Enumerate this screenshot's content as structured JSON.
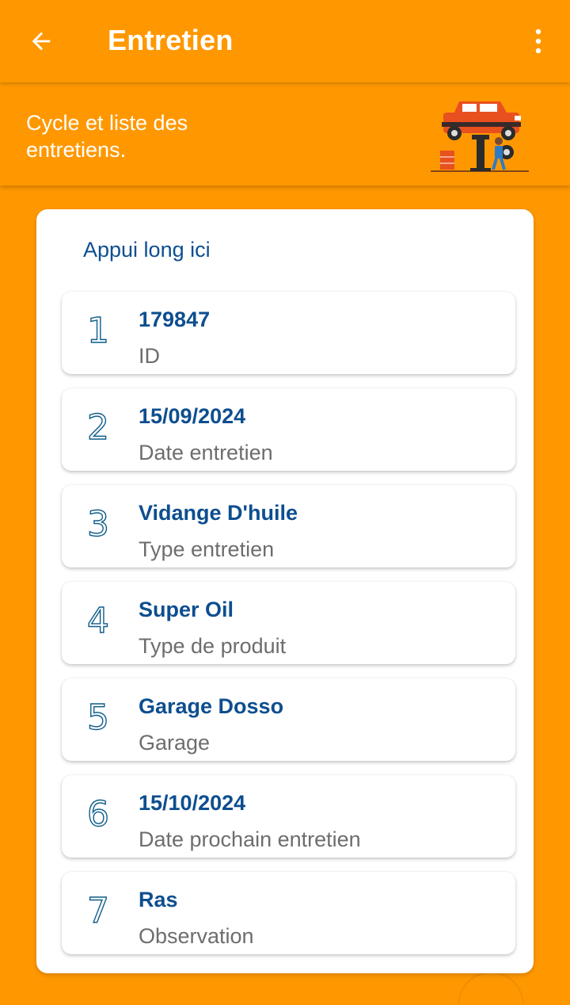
{
  "appbar": {
    "title": "Entretien"
  },
  "header": {
    "description": "Cycle et liste des entretiens."
  },
  "card": {
    "hint": "Appui long ici",
    "items": [
      {
        "num": "1",
        "value": "179847",
        "label": "ID"
      },
      {
        "num": "2",
        "value": "15/09/2024",
        "label": "Date entretien"
      },
      {
        "num": "3",
        "value": "Vidange D'huile",
        "label": "Type entretien"
      },
      {
        "num": "4",
        "value": "Super Oil",
        "label": "Type de produit"
      },
      {
        "num": "5",
        "value": "Garage Dosso",
        "label": "Garage"
      },
      {
        "num": "6",
        "value": "15/10/2024",
        "label": "Date prochain entretien"
      },
      {
        "num": "7",
        "value": "Ras",
        "label": "Observation"
      }
    ]
  },
  "icons": {
    "back": "arrow-left-icon",
    "menu": "more-vert-icon",
    "illustration": "car-lift-mechanic-illustration"
  },
  "colors": {
    "primary": "#FF9800",
    "value_text": "#0D4E8F",
    "label_text": "#6D6D6D",
    "card": "#FFFFFF"
  }
}
